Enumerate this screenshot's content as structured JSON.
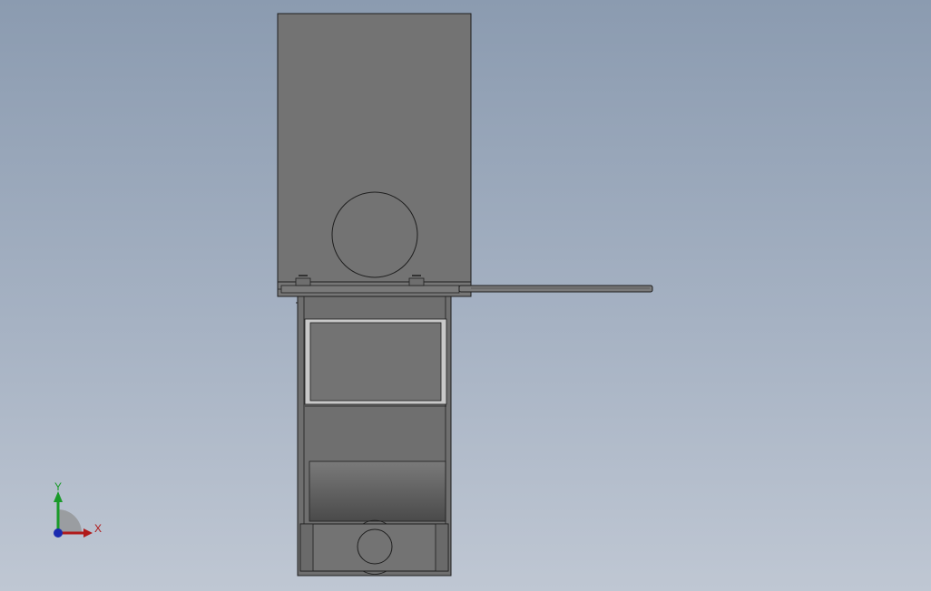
{
  "viewport": {
    "background_top": "#8b9bb0",
    "background_bottom": "#bfc7d3"
  },
  "model": {
    "body_color": "#737373",
    "edge_color": "#1e1e1e",
    "shade_color": "#5e5e5e",
    "light_color": "#c9c9c9"
  },
  "triad": {
    "x_label": "X",
    "y_label": "Y",
    "x_color": "#b01a1a",
    "y_color": "#1a9a2a",
    "z_color": "#1a2ab0"
  }
}
